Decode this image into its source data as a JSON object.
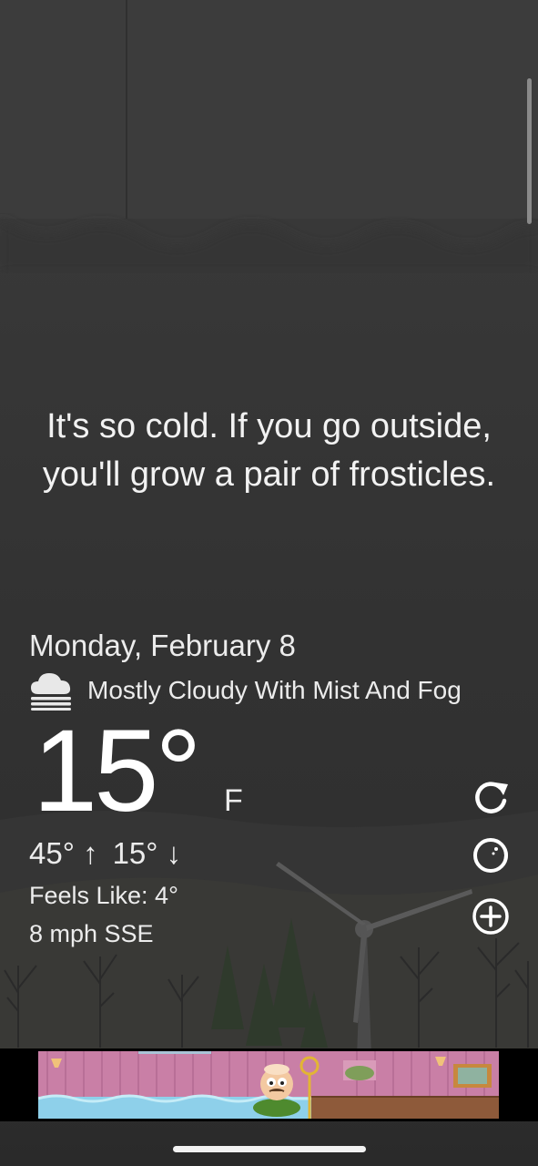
{
  "quote": "It's so cold. If you go outside, you'll grow a pair of frosticles.",
  "date": "Monday, February 8",
  "condition": {
    "icon": "cloud-fog-icon",
    "text": "Mostly Cloudy With Mist And Fog"
  },
  "temperature": {
    "current": "15°",
    "unit": "F",
    "high": "45°",
    "low": "15°",
    "feels_like": "Feels Like: 4°",
    "wind": "8 mph SSE"
  },
  "actions": {
    "refresh_icon": "refresh-icon",
    "theme_icon": "moon-theme-icon",
    "add_icon": "plus-circle-icon"
  },
  "colors": {
    "background": "#333333",
    "text": "#ffffff",
    "ad_pink": "#c97fa6",
    "ad_water": "#8ed0ea"
  }
}
